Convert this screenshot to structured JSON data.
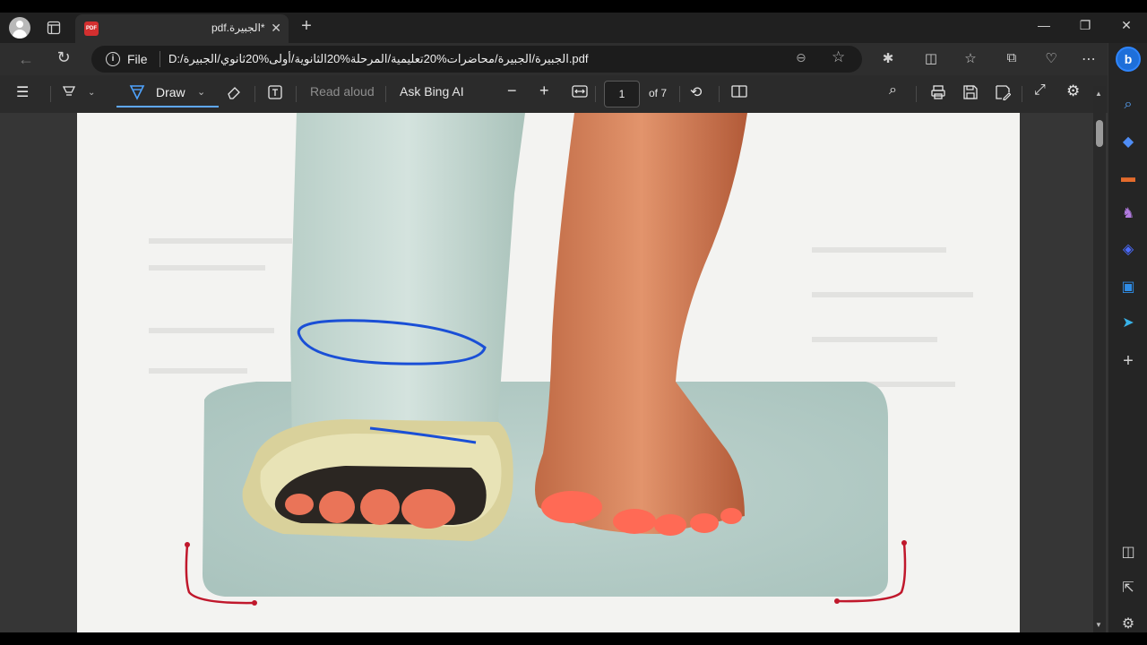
{
  "tabbar": {
    "tab_title": "pdf.الجبيرة*",
    "tab_close": "✕",
    "new_tab": "+",
    "pdf_badge": "PDF",
    "window": {
      "minimize": "—",
      "restore": "❐",
      "close": "✕"
    }
  },
  "address": {
    "file_label": "File",
    "url": "D:/الجبيرة/الجبيرة/محاضرات%20تعليمية/المرحلة%20الثانوية/أولى%20ثانوي/الجبيرة.pdf"
  },
  "pdf_toolbar": {
    "draw_label": "Draw",
    "read_aloud_label": "Read aloud",
    "ask_bing_label": "Ask Bing AI",
    "page_current": "1",
    "page_total": "of 7"
  },
  "sidebar": {
    "bing_letter": "b"
  },
  "colors": {
    "annotation_blue": "#1a4fd6",
    "annotation_red": "#c0182c",
    "accent": "#5fa8ff"
  }
}
